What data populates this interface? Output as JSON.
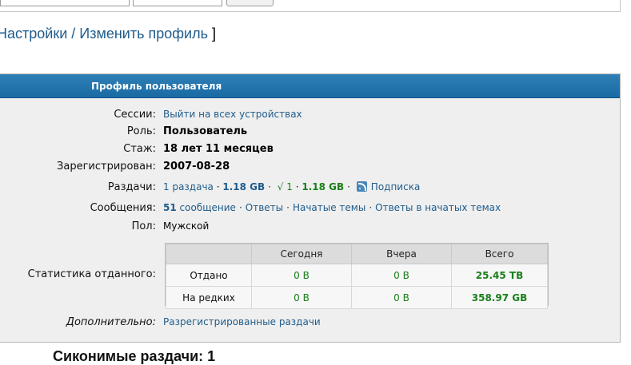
{
  "breadcrumb": {
    "part1": "Настройки",
    "separator": " / ",
    "part2": "Изменить профиль",
    "bracket": " ]"
  },
  "panel": {
    "title": "Профиль пользователя"
  },
  "profile": {
    "sessions_label": "Сессии:",
    "sessions_value": "Выйти на всех устройствах",
    "role_label": "Роль:",
    "role_value": "Пользователь",
    "tenure_label": "Стаж:",
    "tenure_value": "18 лет 11 месяцев",
    "registered_label": "Зарегистрирован:",
    "registered_value": "2007-08-28",
    "distributions_label": "Раздачи:",
    "distributions_count": "1 раздача",
    "distributions_size": "1.18 GB",
    "seeding_mark": "√ 1",
    "seeding_size": "1.18 GB",
    "subscription": "Подписка",
    "messages_label": "Сообщения:",
    "messages_count": "51",
    "messages_word": "сообщение",
    "answers": "Ответы",
    "started_topics": "Начатые темы",
    "answers_in_started": "Ответы в начатых темах",
    "gender_label": "Пол:",
    "gender_value": "Мужской",
    "upload_stats_label": "Статистика отданного:",
    "extra_label": "Дополнительно:",
    "extra_value": "Разрегистрированные раздачи"
  },
  "stats_table": {
    "headers": [
      "",
      "Сегодня",
      "Вчера",
      "Всего"
    ],
    "rows": [
      {
        "label": "Отдано",
        "today": "0 B",
        "yesterday": "0 B",
        "total": "25.45 TB"
      },
      {
        "label": "На редких",
        "today": "0 B",
        "yesterday": "0 B",
        "total": "358.97 GB"
      }
    ]
  },
  "bottom_heading": "Сиконимые раздачи: 1",
  "colors": {
    "link": "#1f5c8c",
    "header": "#1a6aa3",
    "green": "#1a7f1a"
  }
}
